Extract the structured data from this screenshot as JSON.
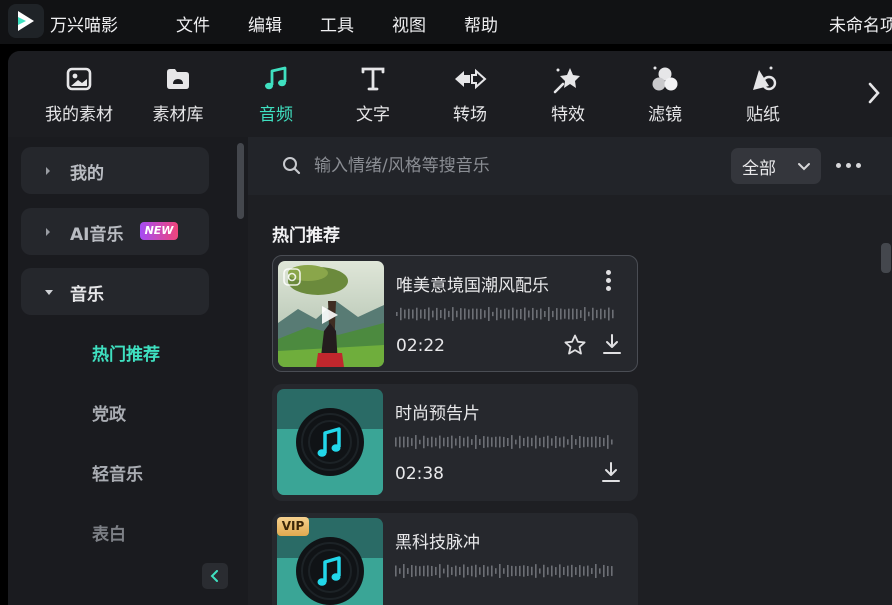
{
  "app": {
    "name": "万兴喵影",
    "logo_icon": "filmora-logo-icon",
    "document_title": "未命名项目"
  },
  "menu": [
    "文件",
    "编辑",
    "工具",
    "视图",
    "帮助"
  ],
  "tabs": [
    {
      "label": "我的素材",
      "icon": "my-media-icon"
    },
    {
      "label": "素材库",
      "icon": "stock-library-icon"
    },
    {
      "label": "音频",
      "icon": "music-note-icon",
      "active": true
    },
    {
      "label": "文字",
      "icon": "text-icon"
    },
    {
      "label": "转场",
      "icon": "transition-icon"
    },
    {
      "label": "特效",
      "icon": "effects-icon"
    },
    {
      "label": "滤镜",
      "icon": "filters-icon"
    },
    {
      "label": "贴纸",
      "icon": "stickers-icon"
    }
  ],
  "sidebar": {
    "categories": [
      {
        "label": "我的",
        "expanded": false
      },
      {
        "label": "AI音乐",
        "expanded": false,
        "badge": "NEW"
      },
      {
        "label": "音乐",
        "expanded": true
      }
    ],
    "subitems": [
      {
        "label": "热门推荐",
        "active": true
      },
      {
        "label": "党政"
      },
      {
        "label": "轻音乐"
      },
      {
        "label": "表白"
      }
    ]
  },
  "search": {
    "placeholder": "输入情绪/风格等搜音乐",
    "filter_value": "全部"
  },
  "section_title": "热门推荐",
  "tracks": [
    {
      "title": "唯美意境国潮风配乐",
      "duration": "02:22",
      "vip": false
    },
    {
      "title": "时尚预告片",
      "duration": "02:38",
      "vip": false
    },
    {
      "title": "黑科技脉冲",
      "duration": "",
      "vip": true,
      "vip_label": "VIP"
    }
  ],
  "colors": {
    "accent": "#3fe0c0",
    "panel": "#1b1c20",
    "card": "#26282d",
    "vip": "#e0a94f"
  }
}
